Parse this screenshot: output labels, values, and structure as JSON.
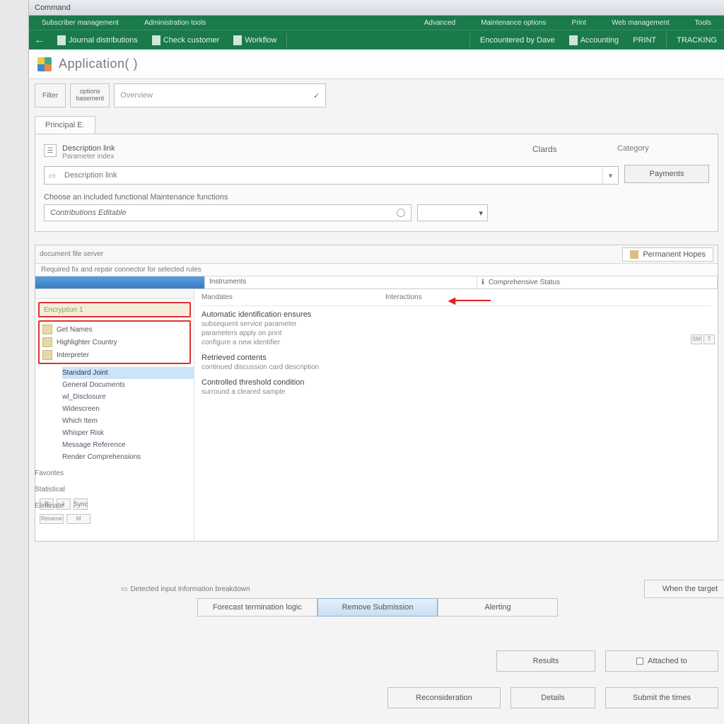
{
  "window": {
    "title": "Command"
  },
  "ribbon": {
    "tabs_left": [
      "Subscriber management",
      "Administration tools"
    ],
    "tabs_right": [
      "Advanced",
      "Maintenance options",
      "Print",
      "Web management",
      "Tools"
    ],
    "back": "←",
    "cmds_left": [
      "Journal distributions",
      "Check customer",
      "Workflow"
    ],
    "cmds_right": [
      "Encountered by Dave",
      "Accounting",
      "PRINT",
      "TRACKING"
    ]
  },
  "page": {
    "title": "Application( )"
  },
  "toolbar": {
    "btn1": "Filter",
    "stack_top": "options",
    "stack_bottom": "basement",
    "field_placeholder": "Overview"
  },
  "subtab": "Principal E.",
  "panel": {
    "head_line1": "Description link",
    "head_line2": "Parameter index",
    "mid_label": "Clards",
    "right_label": "Category",
    "btn": "Payments",
    "sub_label": "Choose an included functional  Maintenance functions",
    "sub_field": "Contributions Editable"
  },
  "editor": {
    "head_left": "document file server",
    "head_btn": "Permanent Hopes",
    "sub_head": "Required fix and repair connector for selected rules",
    "col2": "Instruments",
    "col3": "Comprehensive Status",
    "arrow": true
  },
  "tree": {
    "selected": "Encryption 1",
    "group": [
      "Get Names",
      "Highlighter Country",
      "Interpreter"
    ],
    "list": [
      "Standard Joint",
      "General Documents",
      "wl_Disclosure",
      "Widescreen",
      "Which Item",
      "Whisper Risk",
      "Message Reference",
      "Render Comprehensions"
    ],
    "active_index": 0,
    "btm_toggles": [
      "B",
      "I",
      "Sync"
    ],
    "btm_labels": [
      "Rename",
      "M"
    ]
  },
  "content": {
    "col_a": "Mandates",
    "col_b": "Interactions",
    "line1": "Automatic identification ensures",
    "sub1": "subsequent service parameter",
    "sub2": "parameters apply on print",
    "sub3": "configure a new identifier",
    "sect1": "Retrieved contents",
    "sect1_sub": "continued discussion card description",
    "sect2": "Controlled threshold condition",
    "sect2_sub": "surround a cleared sample",
    "side": [
      "SM",
      "T"
    ]
  },
  "below": {
    "b1": "Favorites",
    "b2": "Statistical",
    "b3": "Eliminate"
  },
  "status": {
    "label": "Detected input  Information breakdown",
    "btn": "When the target"
  },
  "tabs": {
    "t1": "Forecast termination logic",
    "t2": "Remove Submission",
    "t3": "Alerting"
  },
  "actions": {
    "row1_a": "Results",
    "row1_b": "Attached to",
    "row2_a": "Reconsideration",
    "row2_b": "Details",
    "row2_c": "Submit the times"
  }
}
